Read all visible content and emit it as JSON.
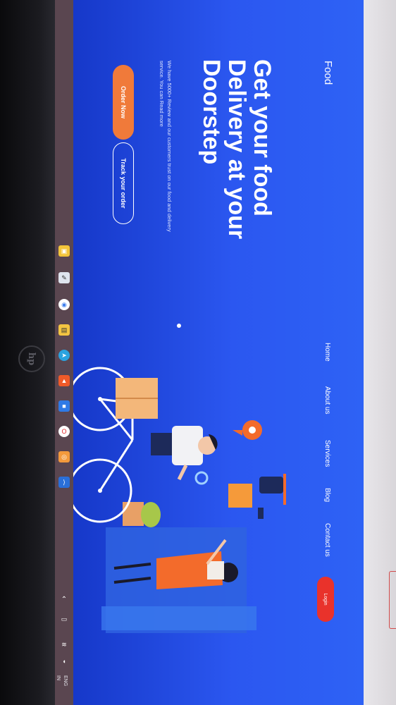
{
  "site": {
    "brand": "Food",
    "nav": [
      "Home",
      "About us",
      "Services",
      "Blog",
      "Contact us"
    ],
    "login_label": "Login"
  },
  "hero": {
    "title": "Get your food Delivery at your Doorstep",
    "description": "We have 5000+ Review and our customers trust on our food and delivery service. You can Read more",
    "order_button": "Order Now",
    "track_button": "Track your order"
  },
  "tray": {
    "language_1": "ENG",
    "language_2": "IN"
  },
  "colors": {
    "hero_bg": "#2b57f0",
    "accent_orange": "#f07a3a",
    "login_red": "#e9322b"
  },
  "icons": [
    "hp-logo",
    "file-explorer-icon",
    "chat-icon",
    "chrome-icon",
    "folder-icon",
    "telegram-icon",
    "brave-icon",
    "app-icon",
    "opera-icon",
    "camera-icon",
    "vscode-icon"
  ]
}
